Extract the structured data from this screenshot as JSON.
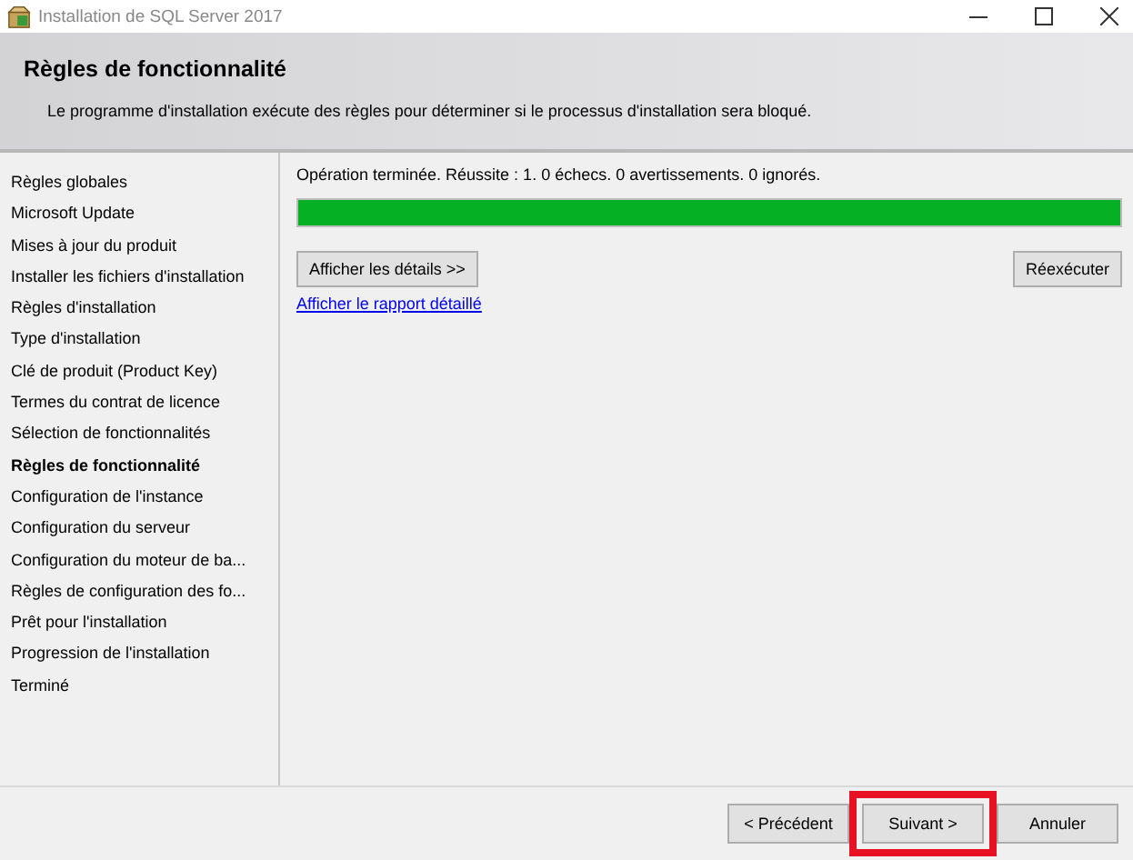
{
  "window": {
    "title": "Installation de SQL Server 2017"
  },
  "header": {
    "title": "Règles de fonctionnalité",
    "description": "Le programme d'installation exécute des règles pour déterminer si le processus d'installation sera bloqué."
  },
  "sidebar": {
    "items": [
      {
        "label": "Règles globales",
        "selected": false
      },
      {
        "label": "Microsoft Update",
        "selected": false
      },
      {
        "label": "Mises à jour du produit",
        "selected": false
      },
      {
        "label": "Installer les fichiers d'installation",
        "selected": false
      },
      {
        "label": "Règles d'installation",
        "selected": false
      },
      {
        "label": "Type d'installation",
        "selected": false
      },
      {
        "label": "Clé de produit (Product Key)",
        "selected": false
      },
      {
        "label": "Termes du contrat de licence",
        "selected": false
      },
      {
        "label": "Sélection de fonctionnalités",
        "selected": false
      },
      {
        "label": "Règles de fonctionnalité",
        "selected": true
      },
      {
        "label": "Configuration de l'instance",
        "selected": false
      },
      {
        "label": "Configuration du serveur",
        "selected": false
      },
      {
        "label": "Configuration du moteur de ba...",
        "selected": false
      },
      {
        "label": "Règles de configuration des fo...",
        "selected": false
      },
      {
        "label": "Prêt pour l'installation",
        "selected": false
      },
      {
        "label": "Progression de l'installation",
        "selected": false
      },
      {
        "label": "Terminé",
        "selected": false
      }
    ]
  },
  "content": {
    "status": "Opération terminée. Réussite : 1. 0 échecs. 0 avertissements. 0 ignorés.",
    "progress": {
      "level": 1
    },
    "details_button": "Afficher les détails >>",
    "rerun_button": "Réexécuter",
    "report_link": "Afficher le rapport détaillé"
  },
  "footer": {
    "buttons": [
      {
        "label": "< Précédent",
        "highlighted": false
      },
      {
        "label": "Suivant >",
        "highlighted": true
      },
      {
        "label": "Annuler",
        "highlighted": false
      }
    ]
  }
}
